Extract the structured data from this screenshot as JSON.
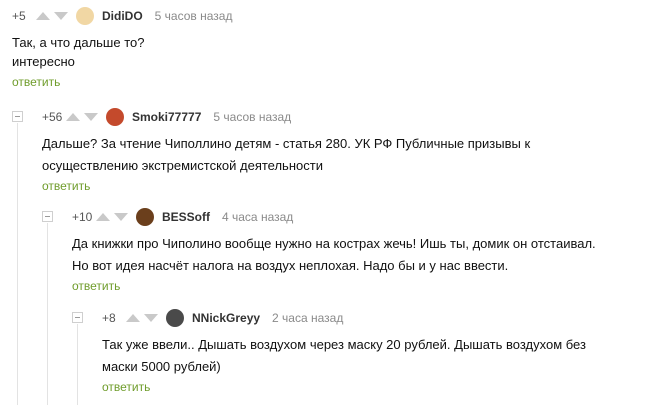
{
  "comments": [
    {
      "rating": "+5",
      "author": "DidiDO",
      "time": "5 часов назад",
      "lines": [
        "Так, а что дальше то?",
        "интересно"
      ],
      "reply": "ответить",
      "avatar_color": "#f1d7a4"
    },
    {
      "rating": "+56",
      "author": "Smoki77777",
      "time": "5 часов назад",
      "lines": [
        "Дальше? За чтение Чиполлино детям - статья 280. УК РФ Публичные призывы к",
        "осуществлению экстремистской деятельности"
      ],
      "reply": "ответить",
      "avatar_color": "#c44a2c"
    },
    {
      "rating": "+10",
      "author": "BESSoff",
      "time": "4 часа назад",
      "lines": [
        "Да книжки про Чиполино вообще нужно на кострах жечь! Ишь ты, домик он отстаивал.",
        "Но вот идея насчёт налога на воздух неплохая. Надо бы и у нас ввести."
      ],
      "reply": "ответить",
      "avatar_color": "#6b3f1c"
    },
    {
      "rating": "+8",
      "author": "NNickGreyy",
      "time": "2 часа назад",
      "lines": [
        "Так уже ввели.. Дышать воздухом через маску 20 рублей. Дышать воздухом без",
        "маски 5000 рублей)"
      ],
      "reply": "ответить",
      "avatar_color": "#4a4a4a"
    }
  ],
  "colors": {
    "reply_link": "#6f9c2b",
    "arrow": "#c9c9c9",
    "thread_line": "#e3e3e3"
  },
  "icons": {
    "upvote": "arrow-up-icon",
    "downvote": "arrow-down-icon",
    "collapse": "collapse-branch-icon"
  }
}
